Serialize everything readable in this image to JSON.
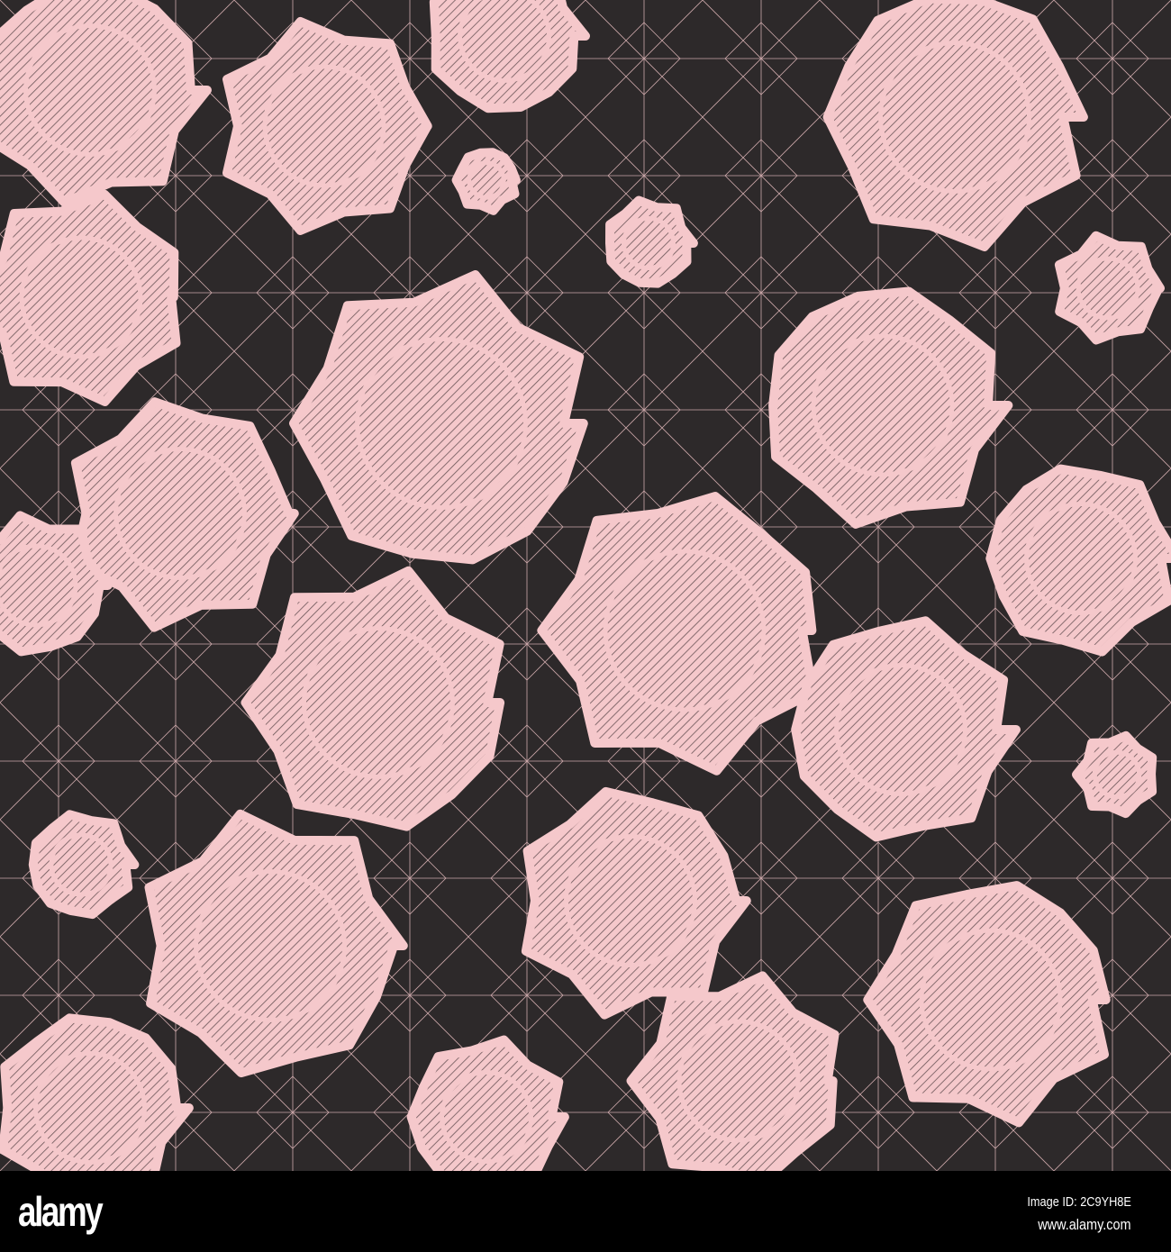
{
  "colors": {
    "background": "#2d292a",
    "pink": "#f5c8cb",
    "hatch": "#6b5558"
  },
  "watermark": {
    "logo": "alamy",
    "image_id": "Image ID: 2C9YH8E",
    "site": "www.alamy.com"
  }
}
